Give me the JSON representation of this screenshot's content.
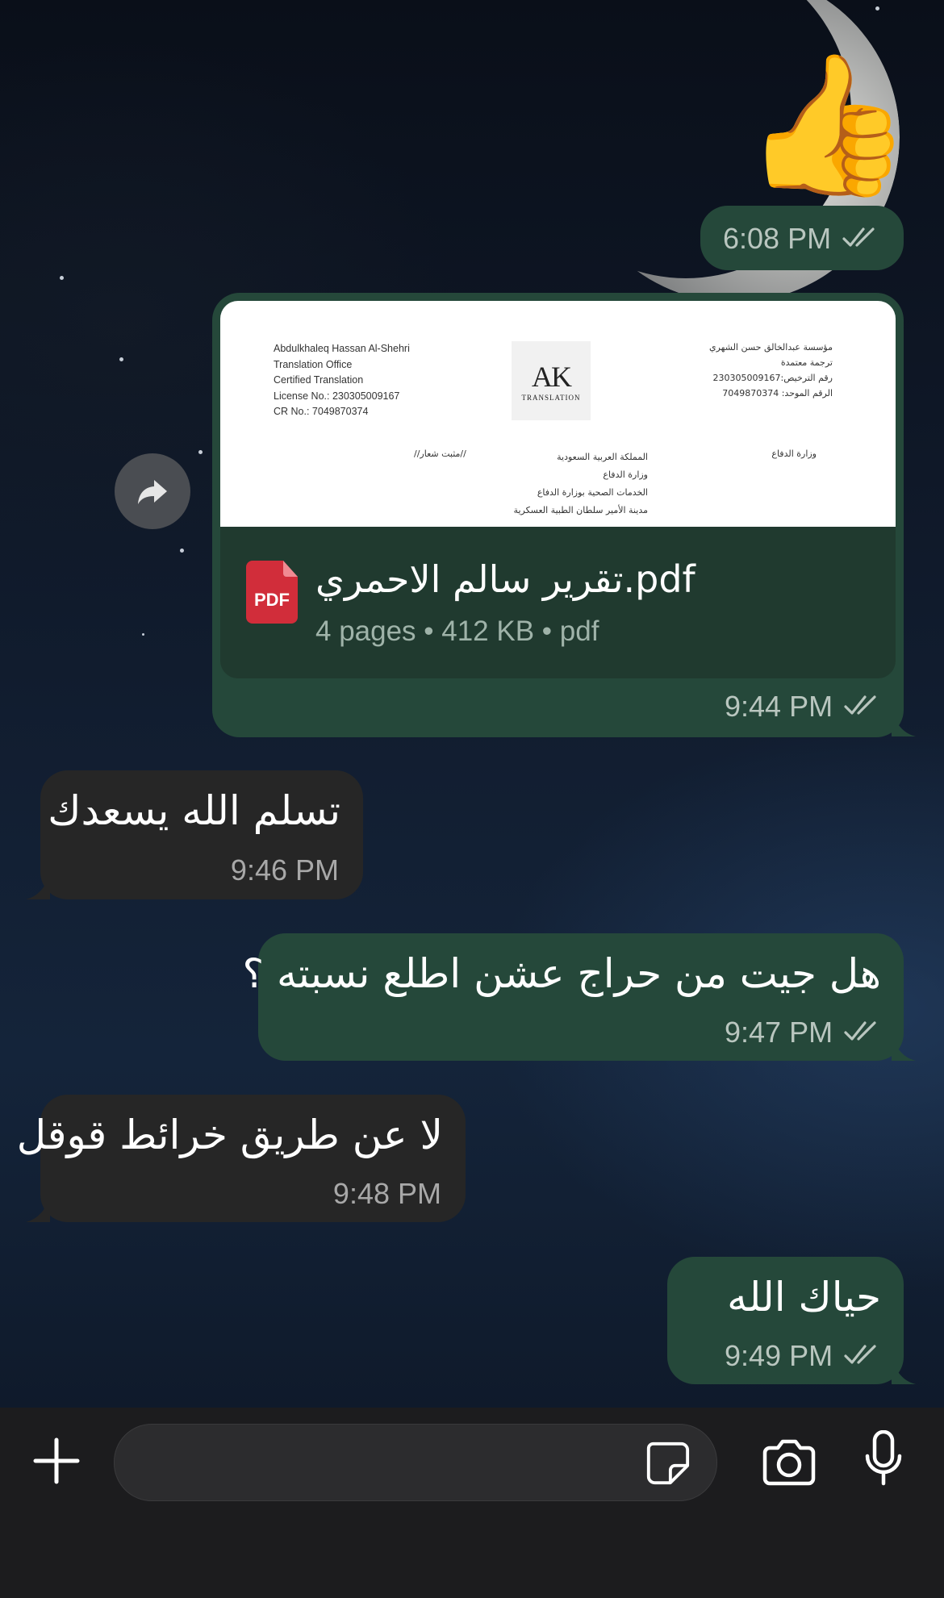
{
  "messages": [
    {
      "type": "emoji",
      "emoji": "👍",
      "time": "6:08 PM",
      "direction": "out",
      "status": "read"
    },
    {
      "type": "document",
      "direction": "out",
      "time": "9:44 PM",
      "status": "read",
      "file_name": "تقرير سالم الاحمري.pdf",
      "file_meta": "4 pages • 412 KB • pdf",
      "preview": {
        "left_lines": [
          "Abdulkhaleq Hassan Al-Shehri",
          "Translation Office",
          "Certified Translation",
          "License No.: 230305009167",
          "CR No.: 7049870374"
        ],
        "right_lines": [
          "مؤسسة عبدالخالق حسن الشهري",
          "ترجمة معتمدة",
          "رقم الترخيص:230305009167",
          "الرقم الموحد: 7049870374"
        ],
        "logo_main": "AK",
        "logo_sub": "TRANSLATION",
        "center_lines": [
          "المملكة العربية السعودية",
          "وزارة الدفاع",
          "الخدمات الصحية بوزارة الدفاع",
          "مدينة الأمير سلطان الطبية العسكرية"
        ],
        "mid_note": "//مثبت شعار//",
        "right_note": "وزارة الدفاع"
      },
      "pdf_badge": "PDF"
    },
    {
      "type": "text",
      "direction": "in",
      "text": "تسلم الله يسعدك",
      "time": "9:46 PM"
    },
    {
      "type": "text",
      "direction": "out",
      "text": "هل جيت من حراج عشن اطلع نسبته ؟",
      "time": "9:47 PM",
      "status": "read"
    },
    {
      "type": "text",
      "direction": "in",
      "text": "لا عن طريق خرائط قوقل",
      "time": "9:48 PM"
    },
    {
      "type": "text",
      "direction": "out",
      "text": "حياك الله",
      "time": "9:49 PM",
      "status": "read"
    }
  ],
  "composer": {
    "icons": [
      "plus-icon",
      "sticker-icon",
      "camera-icon",
      "microphone-icon"
    ],
    "input_value": ""
  },
  "colors": {
    "outgoing_bubble": "#25483a",
    "incoming_bubble": "#262626",
    "composer_bg": "#1c1c1e"
  }
}
